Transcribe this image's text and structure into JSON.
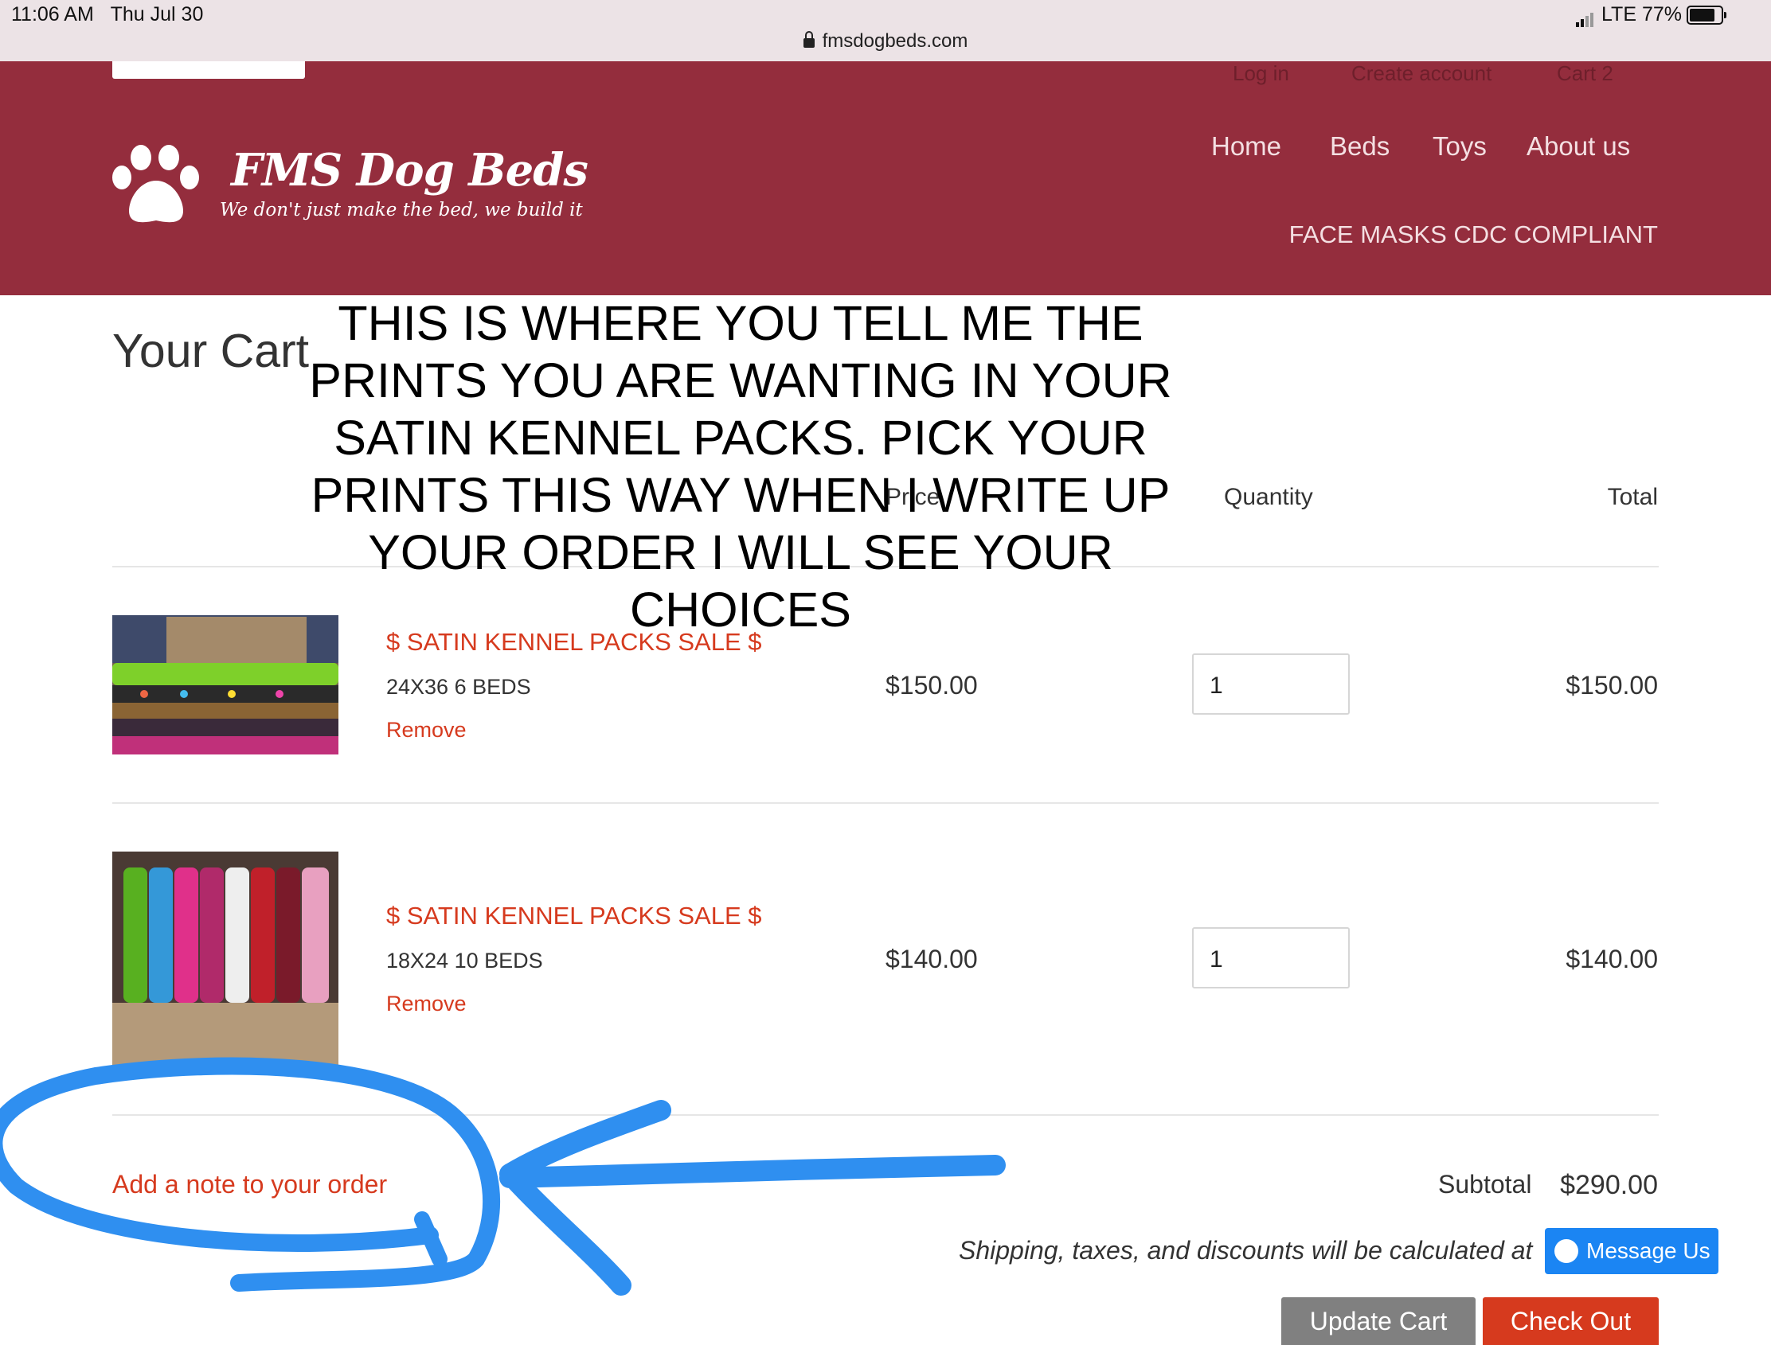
{
  "status_bar": {
    "time": "11:06 AM",
    "date": "Thu Jul 30",
    "network": "LTE",
    "battery": "77%"
  },
  "browser": {
    "url": "fmsdogbeds.com"
  },
  "header": {
    "top_links": [
      "Log in",
      "Create account",
      "Cart 2"
    ],
    "brand": "FMS Dog Beds",
    "tagline": "We don't just make the bed, we build it",
    "nav": [
      "Home",
      "Beds",
      "Toys",
      "About us"
    ],
    "nav_second_row": "FACE MASKS CDC COMPLIANT",
    "accent_color": "#942d3d"
  },
  "cart": {
    "title": "Your Cart",
    "columns": {
      "price": "Price",
      "quantity": "Quantity",
      "total": "Total"
    },
    "items": [
      {
        "title": "$ SATIN KENNEL PACKS SALE $",
        "variant": "24X36 6 BEDS",
        "remove": "Remove",
        "price": "$150.00",
        "quantity": "1",
        "total": "$150.00"
      },
      {
        "title": "$ SATIN KENNEL PACKS SALE $",
        "variant": "18X24 10 BEDS",
        "remove": "Remove",
        "price": "$140.00",
        "quantity": "1",
        "total": "$140.00"
      }
    ],
    "add_note": "Add a note to your order",
    "subtotal_label": "Subtotal",
    "subtotal_value": "$290.00",
    "shipping_note": "Shipping, taxes, and discounts will be calculated at",
    "buttons": {
      "update": "Update Cart",
      "checkout": "Check Out"
    },
    "link_color": "#d63a1e"
  },
  "messenger": {
    "label": "Message Us"
  },
  "overlay_text": "THIS IS WHERE YOU TELL ME THE PRINTS YOU ARE WANTING IN YOUR SATIN KENNEL PACKS. PICK YOUR PRINTS THIS WAY WHEN I WRITE UP YOUR ORDER I WILL SEE YOUR CHOICES",
  "annotation": {
    "color": "#2f8ff0",
    "shapes": [
      "circle",
      "arrow"
    ]
  }
}
